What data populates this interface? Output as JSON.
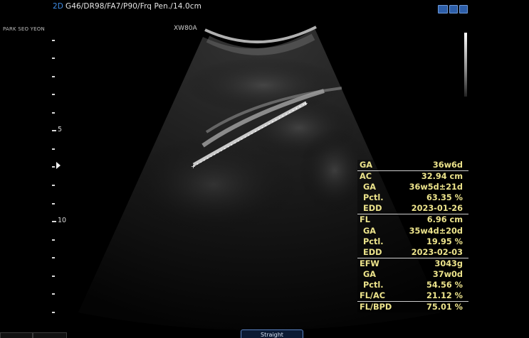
{
  "header": {
    "mode": "2D",
    "params": "G46/DR98/FA7/P90/Frq Pen./14.0cm",
    "patient": "PARK SEO YEON",
    "probe": "XW80A"
  },
  "depth_scale": {
    "labels": [
      {
        "text": "5",
        "name": "depth-label-5"
      },
      {
        "text": "10",
        "name": "depth-label-10"
      }
    ]
  },
  "measurements": {
    "ga_label": "GA",
    "ga_value": "36w6d",
    "ac_label": "AC",
    "ac_value": "32.94 cm",
    "ac_ga_label": "GA",
    "ac_ga_value": "36w5d±21d",
    "ac_pctl_label": "Pctl.",
    "ac_pctl_value": "63.35 %",
    "ac_edd_label": "EDD",
    "ac_edd_value": "2023-01-26",
    "fl_label": "FL",
    "fl_value": "6.96 cm",
    "fl_ga_label": "GA",
    "fl_ga_value": "35w4d±20d",
    "fl_pctl_label": "Pctl.",
    "fl_pctl_value": "19.95 %",
    "fl_edd_label": "EDD",
    "fl_edd_value": "2023-02-03",
    "efw_label": "EFW",
    "efw_value": "3043g",
    "efw_ga_label": "GA",
    "efw_ga_value": "37w0d",
    "efw_pctl_label": "Pctl.",
    "efw_pctl_value": "54.56 %",
    "flac_label": "FL/AC",
    "flac_value": "21.12 %",
    "flbpd_label": "FL/BPD",
    "flbpd_value": "75.01 %"
  },
  "bottom": {
    "straight_button": "Straight"
  },
  "colors": {
    "measurement_text": "#ece38b",
    "mode_accent": "#3f8ce6"
  }
}
